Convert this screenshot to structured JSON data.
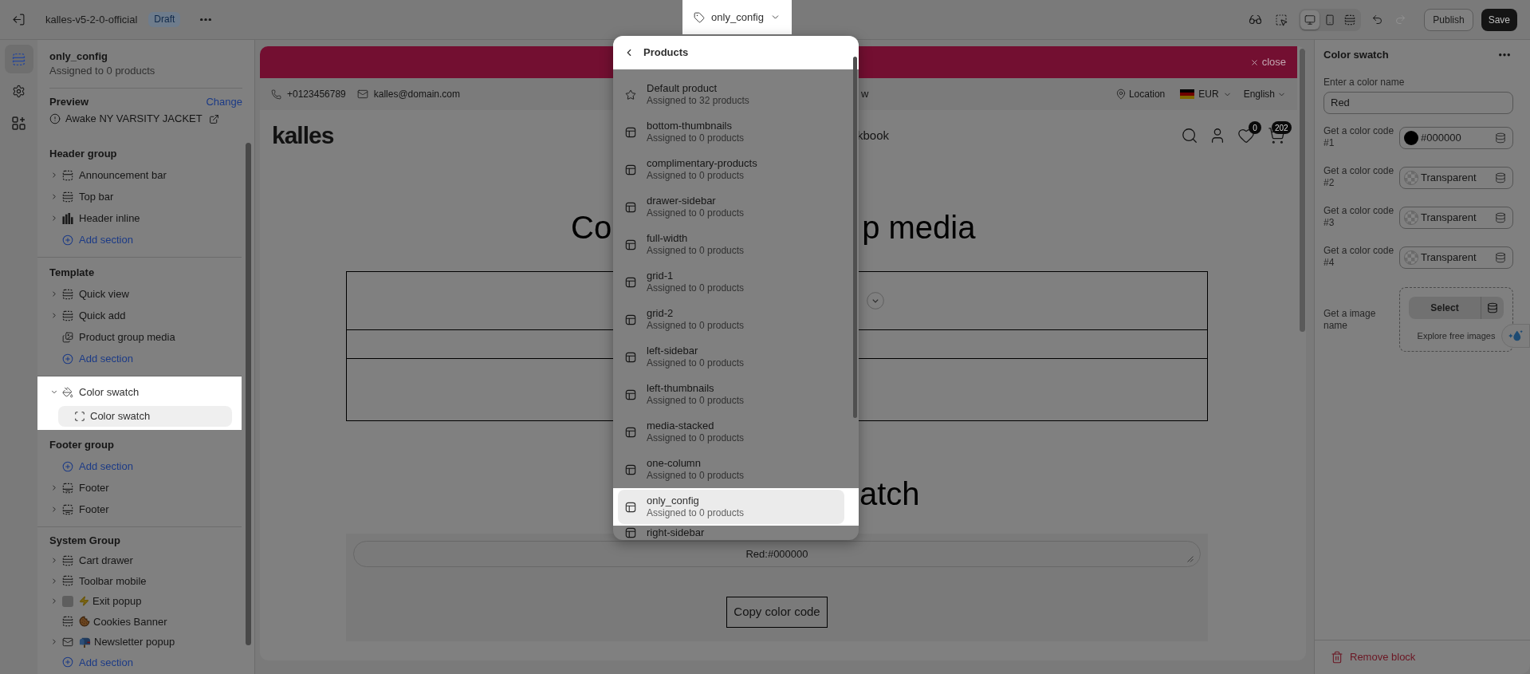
{
  "topbar": {
    "theme_name": "kalles-v5-2-0-official",
    "status": "Draft",
    "template_button": {
      "label": "only_config",
      "highlighted": true
    },
    "view_modes": [
      {
        "selected": true
      },
      {
        "selected": false
      },
      {
        "selected": false
      }
    ],
    "undo": {
      "disabled": false
    },
    "redo": {
      "disabled": true
    },
    "buttons": [
      {
        "label": "Publish",
        "kind": "secondary"
      },
      {
        "label": "Save",
        "kind": "primary"
      }
    ]
  },
  "rail": [
    {
      "selected": true
    },
    {
      "selected": false
    },
    {
      "selected": false
    }
  ],
  "sidebar": {
    "template_title": "only_config",
    "template_subtitle": "Assigned to 0 products",
    "preview_label": "Preview",
    "preview_action": "Change",
    "preview_product": "Awake NY VARSITY JACKET",
    "groups": [
      {
        "title": "Header group",
        "highlighted": false,
        "items": [
          {
            "kind": "section",
            "label": "Announcement bar",
            "collapsible": true,
            "expanded": false
          },
          {
            "kind": "section",
            "label": "Top bar",
            "collapsible": true,
            "expanded": false
          },
          {
            "kind": "section",
            "label": "Header inline",
            "collapsible": true,
            "expanded": false
          },
          {
            "kind": "add",
            "label": "Add section"
          }
        ]
      },
      {
        "title": "Template",
        "highlighted": false,
        "items": [
          {
            "kind": "section",
            "label": "Quick view",
            "collapsible": true,
            "expanded": false
          },
          {
            "kind": "section",
            "label": "Quick add",
            "collapsible": true,
            "expanded": false
          },
          {
            "kind": "section",
            "label": "Product group media",
            "collapsible": false
          },
          {
            "kind": "add",
            "label": "Add section"
          }
        ]
      },
      {
        "highlighted": true,
        "items": [
          {
            "kind": "section",
            "label": "Color swatch",
            "collapsible": true,
            "expanded": true,
            "children": [
              {
                "label": "Color swatch",
                "selected": true
              }
            ]
          }
        ]
      },
      {
        "title": "Footer group",
        "highlighted": false,
        "items": [
          {
            "kind": "add",
            "label": "Add section"
          },
          {
            "kind": "section",
            "label": "Footer",
            "collapsible": true,
            "expanded": false
          },
          {
            "kind": "section",
            "label": "Footer",
            "collapsible": true,
            "expanded": false
          }
        ]
      },
      {
        "title": "System Group",
        "highlighted": false,
        "items": [
          {
            "kind": "section",
            "label": "Cart drawer",
            "collapsible": true,
            "expanded": false
          },
          {
            "kind": "section",
            "label": "Toolbar mobile",
            "collapsible": true,
            "expanded": false
          },
          {
            "kind": "section",
            "label": "Exit popup",
            "collapsible": true,
            "expanded": false
          },
          {
            "kind": "section",
            "label": "Cookies Banner",
            "collapsible": false
          },
          {
            "kind": "section",
            "label": "Newsletter popup",
            "collapsible": true,
            "expanded": false
          },
          {
            "kind": "add",
            "label": "Add section"
          }
        ]
      }
    ]
  },
  "storefront": {
    "announcement_close": "close",
    "phone": "+0123456789",
    "email": "kalles@domain.com",
    "topbar_center_text": "w",
    "location": "Location",
    "currency": "EUR",
    "language": "English",
    "logo": "kalles",
    "nav_text": "kbook",
    "wishlist_count": "0",
    "cart_count": "202",
    "heading_1_parts": [
      "Co",
      "p media"
    ],
    "heading_2_text": "atch",
    "swatch_output": "Red:#000000",
    "copy_button": "Copy color code"
  },
  "template_menu": {
    "header_highlighted": true,
    "title": "Products",
    "items": [
      {
        "kind": "default",
        "name": "Default product",
        "subtitle": "Assigned to 32 products",
        "selected": false
      },
      {
        "kind": "template",
        "name": "bottom-thumbnails",
        "subtitle": "Assigned to 0 products",
        "selected": false
      },
      {
        "kind": "template",
        "name": "complimentary-products",
        "subtitle": "Assigned to 0 products",
        "selected": false
      },
      {
        "kind": "template",
        "name": "drawer-sidebar",
        "subtitle": "Assigned to 0 products",
        "selected": false
      },
      {
        "kind": "template",
        "name": "full-width",
        "subtitle": "Assigned to 0 products",
        "selected": false
      },
      {
        "kind": "template",
        "name": "grid-1",
        "subtitle": "Assigned to 0 products",
        "selected": false
      },
      {
        "kind": "template",
        "name": "grid-2",
        "subtitle": "Assigned to 0 products",
        "selected": false
      },
      {
        "kind": "template",
        "name": "left-sidebar",
        "subtitle": "Assigned to 0 products",
        "selected": false
      },
      {
        "kind": "template",
        "name": "left-thumbnails",
        "subtitle": "Assigned to 0 products",
        "selected": false
      },
      {
        "kind": "template",
        "name": "media-stacked",
        "subtitle": "Assigned to 0 products",
        "selected": false
      },
      {
        "kind": "template",
        "name": "one-column",
        "subtitle": "Assigned to 0 products",
        "selected": false
      },
      {
        "kind": "template",
        "name": "only_config",
        "subtitle": "Assigned to 0 products",
        "selected": true
      },
      {
        "kind": "template",
        "name": "right-sidebar",
        "selected": false
      }
    ]
  },
  "block_panel": {
    "title": "Color swatch",
    "name_label": "Enter a color name",
    "name_value": "Red",
    "color_fields": [
      {
        "label": "Get a color code #1",
        "value": "#000000",
        "transparent": false,
        "color": "#000000"
      },
      {
        "label": "Get a color code #2",
        "value": "Transparent",
        "transparent": true
      },
      {
        "label": "Get a color code #3",
        "value": "Transparent",
        "transparent": true
      },
      {
        "label": "Get a color code #4",
        "value": "Transparent",
        "transparent": true
      }
    ],
    "image_label": "Get a image name",
    "image_button": "Select",
    "image_link": "Explore free images",
    "remove_label": "Remove block"
  }
}
